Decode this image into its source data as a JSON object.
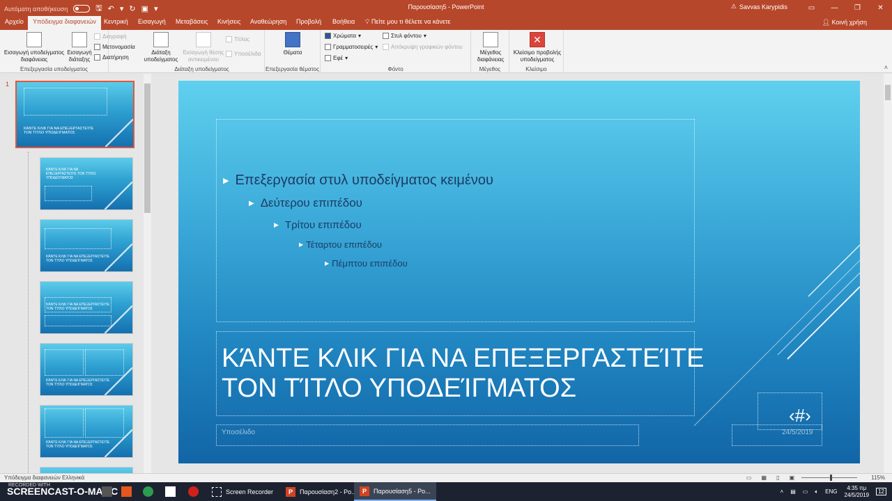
{
  "titlebar": {
    "autosave_label": "Αυτόματη αποθήκευση",
    "autosave_state": "off",
    "window_title": "Παρουσίαση5 - PowerPoint",
    "user_name": "Savvas Karypidis"
  },
  "tabs": {
    "items": [
      "Αρχείο",
      "Υπόδειγμα διαφανειών",
      "Κεντρική",
      "Εισαγωγή",
      "Μεταβάσεις",
      "Κινήσεις",
      "Αναθεώρηση",
      "Προβολή",
      "Βοήθεια"
    ],
    "active": "Υπόδειγμα διαφανειών",
    "tell_me": "Πείτε μου τι θέλετε να κάνετε",
    "share": "Κοινή χρήση"
  },
  "ribbon": {
    "insert_master": "Εισαγωγή υποδείγματος διαφάνειας",
    "insert_layout": "Εισαγωγή διάταξης",
    "delete": "Διαγραφή",
    "rename": "Μετονομασία",
    "preserve": "Διατήρηση",
    "group_edit_master": "Επεξεργασία υποδείγματος",
    "master_layout": "Διάταξη υποδείγματος",
    "insert_placeholder": "Εισαγωγή θέσης αντικειμένου",
    "title_check": "Τίτλος",
    "footers_check": "Υποσέλιδα",
    "group_master_layout": "Διάταξη υποδείγματος",
    "themes": "Θέματα",
    "group_edit_theme": "Επεξεργασία θέματος",
    "colors": "Χρώματα",
    "fonts": "Γραμματοσειρές",
    "effects": "Εφέ",
    "background_styles": "Στυλ φόντου",
    "hide_background": "Απόκρυψη γραφικών φόντου",
    "group_background": "Φόντο",
    "slide_size": "Μέγεθος διαφάνειας",
    "group_size": "Μέγεθος",
    "close_master": "Κλείσιμο προβολής υποδείγματος",
    "group_close": "Κλείσιμο"
  },
  "thumbnails": {
    "master_number": "1",
    "master_title": "ΚΆΝΤΕ ΚΛΙΚ ΓΙΑ ΝΑ ΕΠΕΞΕΡΓΑΣΤΕΊΤΕ ΤΟΝ ΤΊΤΛΟ ΥΠΟΔΕΊΓΜΑΤΟΣ",
    "layout_title": "ΚΆΝΤΕ ΚΛΙΚ ΓΙΑ ΝΑ ΕΠΕΞΕΡΓΑΣΤΕΊΤΕ ΤΟΝ ΤΊΤΛΟ ΥΠΟΔΕΊΓΜΑΤΟΣ"
  },
  "slide": {
    "levels": [
      "Επεξεργασία στυλ υποδείγματος κειμένου",
      "Δεύτερου επιπέδου",
      "Τρίτου επιπέδου",
      "Τέταρτου επιπέδου",
      "Πέμπτου επιπέδου"
    ],
    "title": "ΚΆΝΤΕ ΚΛΙΚ ΓΙΑ ΝΑ ΕΠΕΞΕΡΓΑΣΤΕΊΤΕ\nΤΟΝ ΤΊΤΛΟ ΥΠΟΔΕΊΓΜΑΤΟΣ",
    "footer": "Υποσέλιδο",
    "date": "24/5/2019",
    "page_number": "‹#›"
  },
  "statusbar": {
    "label": "Υπόδειγμα διαφανειών    Ελληνικά",
    "zoom": "115%"
  },
  "taskbar": {
    "watermark": "SCREENCAST-O-MATIC",
    "recorded_with": "RECORDED WITH",
    "apps": [
      "Screen Recorder",
      "Παρουσίαση2 - Po...",
      "Παρουσίαση5 - Po..."
    ],
    "lang": "ENG",
    "time": "4:35 πμ",
    "date": "24/5/2019",
    "notifications": "12"
  },
  "colors": {
    "accent": "#b7472a",
    "slide_top": "#5fd0ee",
    "slide_bottom": "#1265a6"
  }
}
